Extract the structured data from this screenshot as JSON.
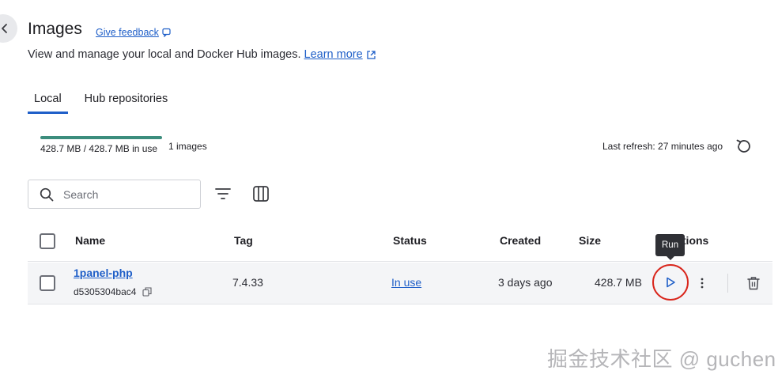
{
  "header": {
    "title": "Images",
    "feedback_label": "Give feedback",
    "description": "View and manage your local and Docker Hub images.",
    "learn_more_label": "Learn more"
  },
  "tabs": [
    {
      "label": "Local",
      "active": true
    },
    {
      "label": "Hub repositories",
      "active": false
    }
  ],
  "usage": {
    "text": "428.7 MB / 428.7 MB in use",
    "fraction_used": 1.0,
    "count": "1 images",
    "last_refresh": "Last refresh: 27 minutes ago"
  },
  "search": {
    "placeholder": "Search",
    "value": ""
  },
  "table": {
    "columns": [
      "Name",
      "Tag",
      "Status",
      "Created",
      "Size",
      "Actions"
    ],
    "rows": [
      {
        "name": "1panel-php",
        "id": "d5305304bac4",
        "tag": "7.4.33",
        "status": "In use",
        "created": "3 days ago",
        "size": "428.7 MB"
      }
    ]
  },
  "tooltip": {
    "text": "Run"
  },
  "watermark": "掘金技术社区 @ guchen",
  "colors": {
    "accent": "#1f5fc8",
    "usage_bar": "#3c8d7d",
    "highlight_circle": "#d9261c",
    "row_background": "#f4f5f7"
  }
}
